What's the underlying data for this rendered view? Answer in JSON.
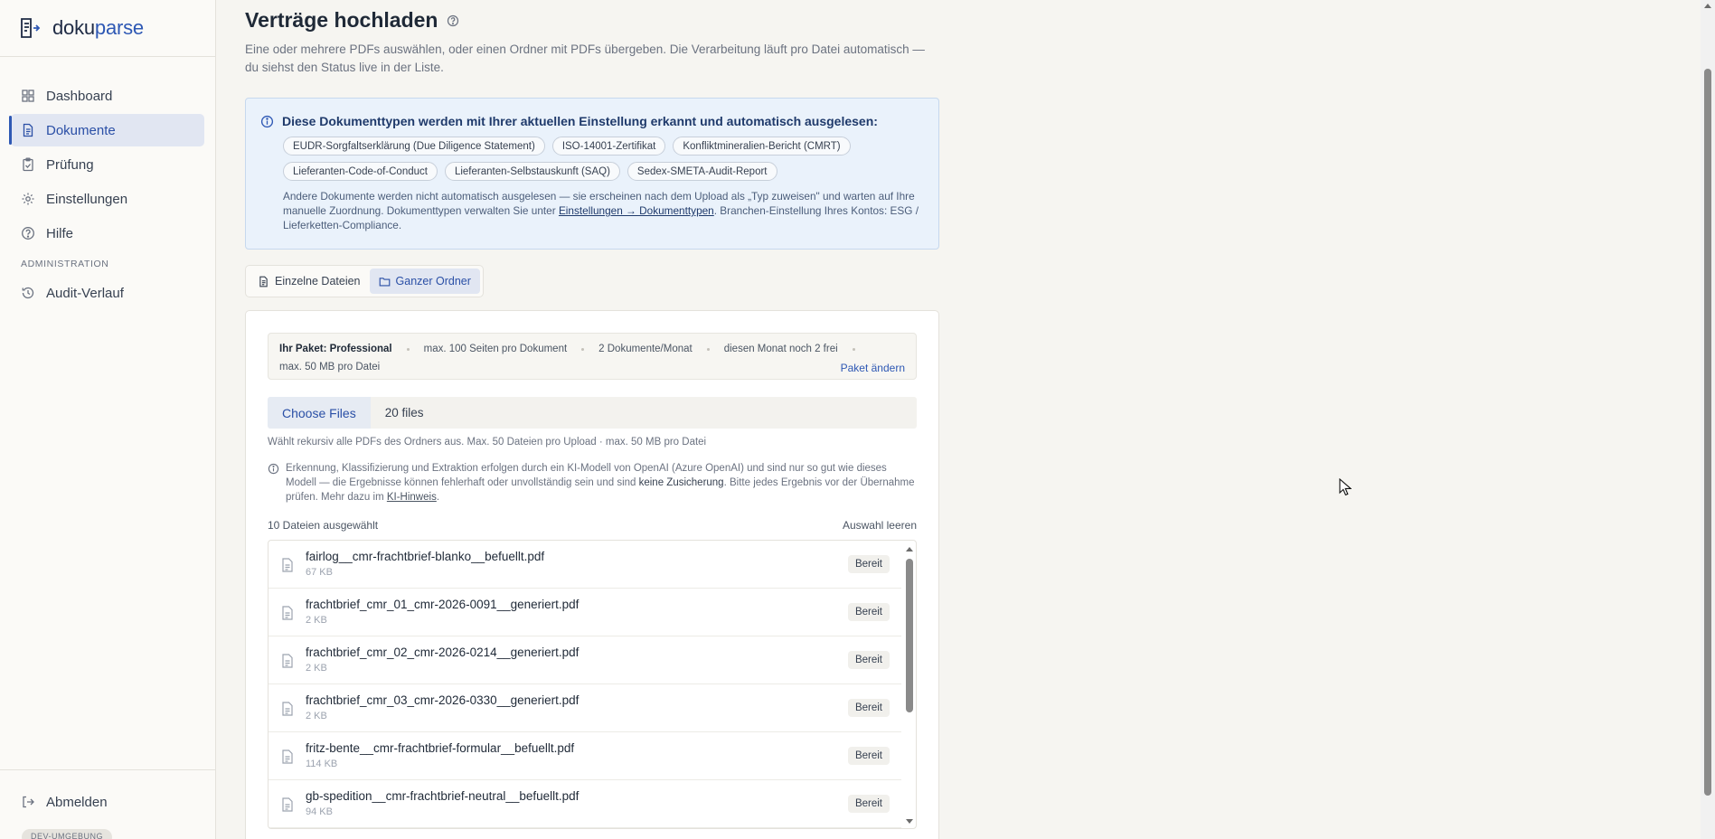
{
  "brand": {
    "part1": "doku",
    "part2": "parse"
  },
  "sidebar": {
    "items": [
      {
        "label": "Dashboard",
        "icon": "dashboard-icon"
      },
      {
        "label": "Dokumente",
        "icon": "document-icon"
      },
      {
        "label": "Prüfung",
        "icon": "clipboard-check-icon"
      },
      {
        "label": "Einstellungen",
        "icon": "gear-icon"
      },
      {
        "label": "Hilfe",
        "icon": "help-circle-icon"
      }
    ],
    "section_admin": "ADMINISTRATION",
    "admin_items": [
      {
        "label": "Audit-Verlauf",
        "icon": "history-icon"
      }
    ],
    "logout": "Abmelden",
    "env_badge": "DEV-UMGEBUNG"
  },
  "page": {
    "title": "Verträge hochladen",
    "description": "Eine oder mehrere PDFs auswählen, oder einen Ordner mit PDFs übergeben. Die Verarbeitung läuft pro Datei automatisch — du siehst den Status live in der Liste."
  },
  "info": {
    "heading": "Diese Dokumenttypen werden mit Ihrer aktuellen Einstellung erkannt und automatisch ausgelesen:",
    "chips": [
      "EUDR-Sorgfaltserklärung (Due Diligence Statement)",
      "ISO-14001-Zertifikat",
      "Konfliktmineralien-Bericht (CMRT)",
      "Lieferanten-Code-of-Conduct",
      "Lieferanten-Selbstauskunft (SAQ)",
      "Sedex-SMETA-Audit-Report"
    ],
    "note_part1": "Andere Dokumente werden nicht automatisch ausgelesen — sie erscheinen nach dem Upload als „Typ zuweisen\" und warten auf Ihre manuelle Zuordnung. Dokumenttypen verwalten Sie unter ",
    "note_link": "Einstellungen → Dokumenttypen",
    "note_part2": ". Branchen-Einstellung Ihres Kontos: ESG / Lieferketten-Compliance."
  },
  "tabs": {
    "single": "Einzelne Dateien",
    "folder": "Ganzer Ordner"
  },
  "plan": {
    "label": "Ihr Paket: Professional",
    "pages": "max. 100 Seiten pro Dokument",
    "docs": "2 Dokumente/Monat",
    "remaining": "diesen Monat noch 2 frei",
    "size": "max. 50 MB pro Datei",
    "change": "Paket ändern"
  },
  "picker": {
    "button": "Choose Files",
    "count": "20 files"
  },
  "hint": "Wählt rekursiv alle PDFs des Ordners aus. Max. 50 Dateien pro Upload · max. 50 MB pro Datei",
  "disclaimer": {
    "part1": "Erkennung, Klassifizierung und Extraktion erfolgen durch ein KI-Modell von OpenAI (Azure OpenAI) und sind nur so gut wie dieses Modell — die Ergebnisse können fehlerhaft oder unvollständig sein und sind ",
    "strong": "keine Zusicherung",
    "part2": ". Bitte jedes Ergebnis vor der Übernahme prüfen. Mehr dazu im ",
    "link": "KI-Hinweis",
    "part3": "."
  },
  "selection": {
    "count": "10 Dateien ausgewählt",
    "clear": "Auswahl leeren"
  },
  "files": [
    {
      "name": "fairlog__cmr-frachtbrief-blanko__befuellt.pdf",
      "size": "67 KB",
      "status": "Bereit"
    },
    {
      "name": "frachtbrief_cmr_01_cmr-2026-0091__generiert.pdf",
      "size": "2 KB",
      "status": "Bereit"
    },
    {
      "name": "frachtbrief_cmr_02_cmr-2026-0214__generiert.pdf",
      "size": "2 KB",
      "status": "Bereit"
    },
    {
      "name": "frachtbrief_cmr_03_cmr-2026-0330__generiert.pdf",
      "size": "2 KB",
      "status": "Bereit"
    },
    {
      "name": "fritz-bente__cmr-frachtbrief-formular__befuellt.pdf",
      "size": "114 KB",
      "status": "Bereit"
    },
    {
      "name": "gb-spedition__cmr-frachtbrief-neutral__befuellt.pdf",
      "size": "94 KB",
      "status": "Bereit"
    }
  ],
  "colors": {
    "accent": "#2e58b4",
    "info_bg": "#eaf2fb",
    "page_bg": "#f6f5f1"
  }
}
